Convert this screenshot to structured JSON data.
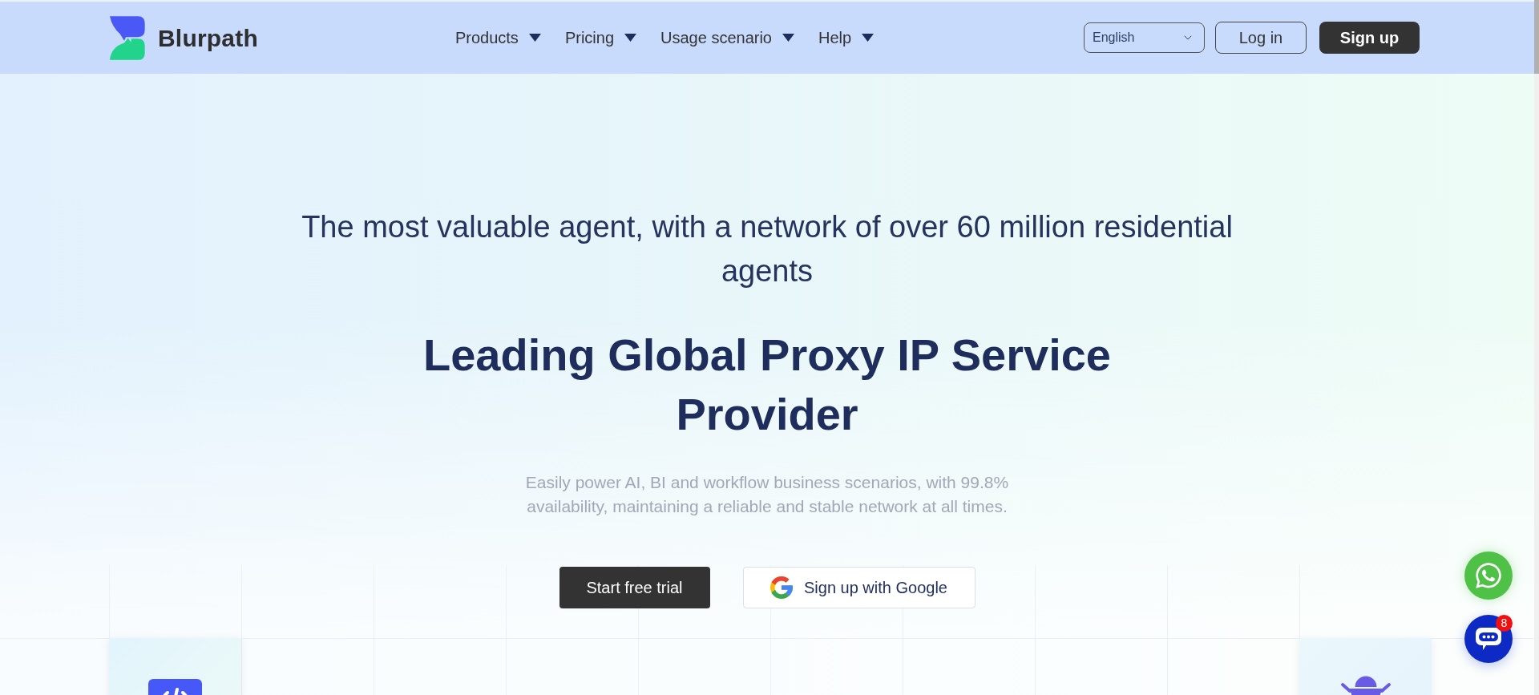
{
  "header": {
    "brand": "Blurpath",
    "nav": [
      {
        "label": "Products"
      },
      {
        "label": "Pricing"
      },
      {
        "label": "Usage scenario"
      },
      {
        "label": "Help"
      }
    ],
    "language": {
      "value": "English"
    },
    "buttons": [
      {
        "label": "Log in",
        "kind": "outline"
      },
      {
        "label": "Sign up",
        "kind": "solid"
      }
    ]
  },
  "hero": {
    "tagline": "The most valuable agent, with a network of over 60 million residential agents",
    "title": "Leading Global Proxy IP Service Provider",
    "description": "Easily power AI, BI and workflow business scenarios, with 99.8% availability, maintaining a reliable and stable network at all times.",
    "actions": [
      {
        "label": "Start free trial",
        "kind": "primary"
      },
      {
        "label": "Sign up with Google",
        "kind": "google"
      }
    ]
  },
  "floating": {
    "chat_badge": "8"
  }
}
